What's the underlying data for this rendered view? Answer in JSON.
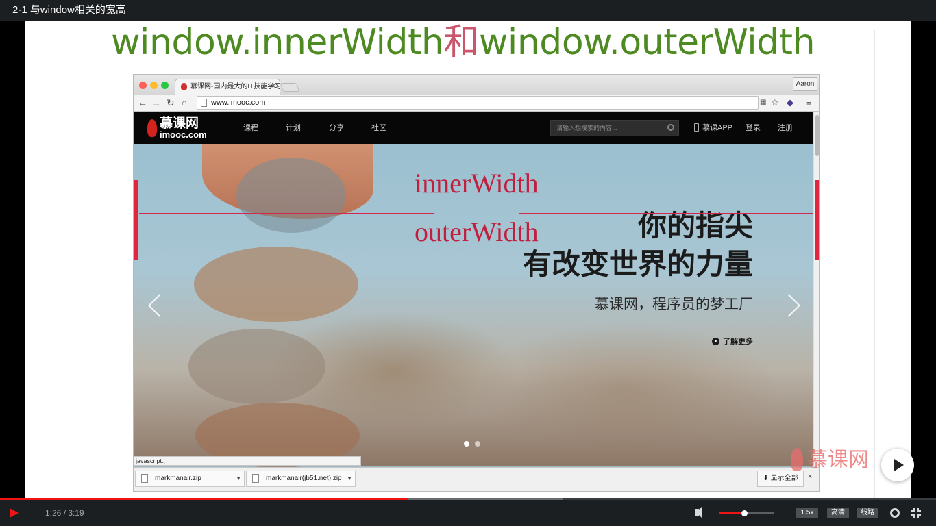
{
  "player": {
    "title": "2-1 与window相关的宽高",
    "time": "1:26 / 3:19",
    "progress_fraction": 0.436,
    "buffer_fraction": 0.602,
    "volume_fraction": 0.45,
    "speed_label": "1.5x",
    "quality_label": "高清",
    "route_label": "线路",
    "accent_color": "#f01414",
    "icons": [
      "play-icon",
      "volume-icon",
      "settings-gear-icon",
      "exit-fullscreen-icon",
      "big-play-icon"
    ]
  },
  "slide": {
    "title_part1": "window.innerWidth",
    "title_part2": "和",
    "title_part3": "window.outerWidth",
    "title_part4": "",
    "annot_inner": "innerWidth",
    "annot_outer": "outerWidth",
    "annot_color": "#c21f3e"
  },
  "browser": {
    "tab_title": "慕课网-国内最大的IT技能学习",
    "tab_close": "×",
    "profile": "Aaron",
    "url": "www.imooc.com",
    "status_text": "javascript:;",
    "downloads": [
      "markmanair.zip",
      "markmanair(jb51.net).zip"
    ],
    "show_all": "显示全部",
    "shelf_close": "×"
  },
  "site": {
    "logo_cn": "慕课网",
    "logo_en": "imooc.com",
    "nav": [
      "课程",
      "计划",
      "分享",
      "社区"
    ],
    "search_placeholder": "请输入想搜索的内容...",
    "app_link": "慕课APP",
    "login": "登录",
    "register": "注册",
    "hero_line1": "你的指尖",
    "hero_line2": "有改变世界的力量",
    "hero_sub": "慕课网，程序员的梦工厂",
    "hero_more": "了解更多"
  },
  "watermark": {
    "text": "慕课网"
  }
}
